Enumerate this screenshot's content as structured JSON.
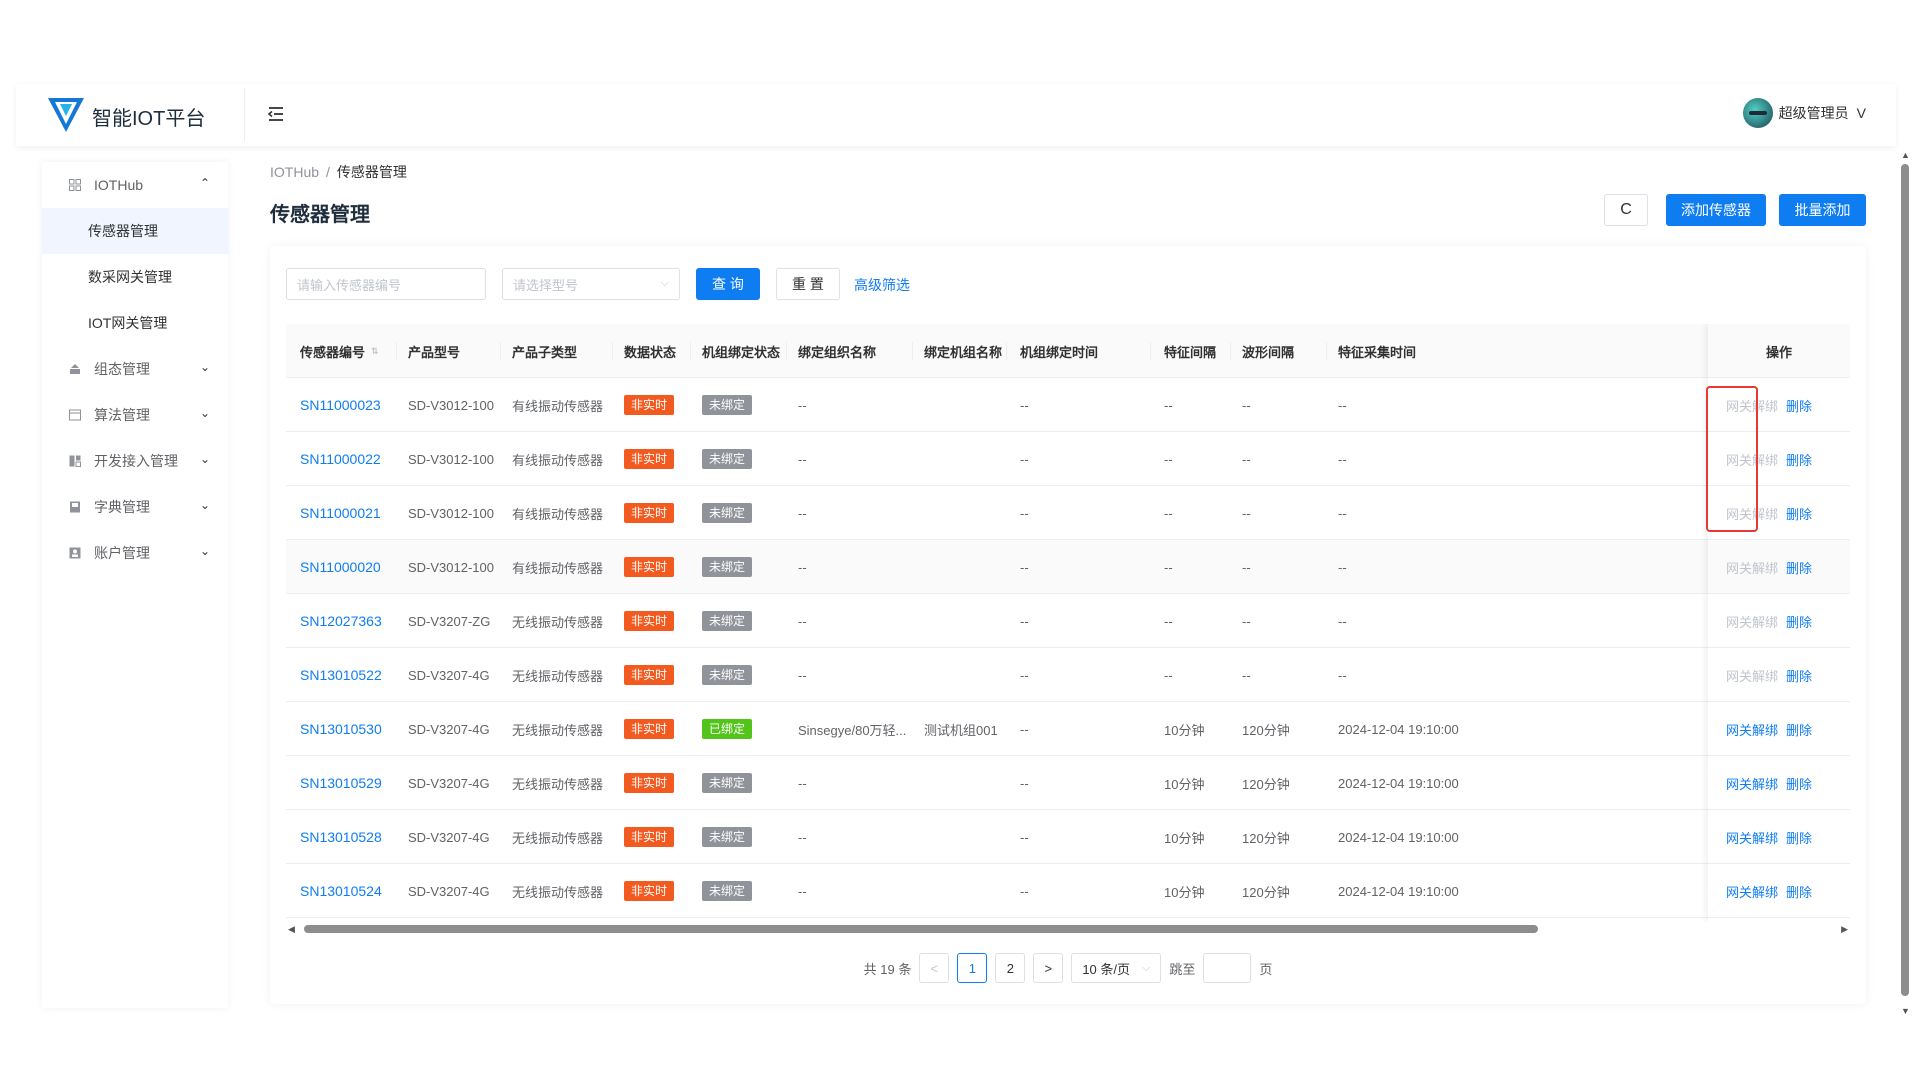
{
  "header": {
    "brand": "智能IOT平台",
    "user_name": "超级管理员",
    "user_chevron": "V"
  },
  "sidebar": {
    "groups": [
      {
        "label": "IOTHub",
        "icon": "grid-icon",
        "expanded": true,
        "items": [
          {
            "label": "传感器管理",
            "active": true
          },
          {
            "label": "数采网关管理",
            "active": false
          },
          {
            "label": "IOT网关管理",
            "active": false
          }
        ]
      },
      {
        "label": "组态管理",
        "icon": "layers-icon",
        "expanded": false,
        "items": []
      },
      {
        "label": "算法管理",
        "icon": "algorithm-icon",
        "expanded": false,
        "items": []
      },
      {
        "label": "开发接入管理",
        "icon": "dev-icon",
        "expanded": false,
        "items": []
      },
      {
        "label": "字典管理",
        "icon": "book-icon",
        "expanded": false,
        "items": []
      },
      {
        "label": "账户管理",
        "icon": "account-icon",
        "expanded": false,
        "items": []
      }
    ]
  },
  "breadcrumb": {
    "root": "IOTHub",
    "sep": "/",
    "current": "传感器管理"
  },
  "page_title": "传感器管理",
  "toolbar": {
    "refresh_icon": "C",
    "add_label": "添加传感器",
    "batch_label": "批量添加"
  },
  "filters": {
    "sn_placeholder": "请输入传感器编号",
    "model_placeholder": "请选择型号",
    "query_label": "查 询",
    "reset_label": "重 置",
    "advanced_label": "高级筛选"
  },
  "table": {
    "columns": [
      "传感器编号",
      "产品型号",
      "产品子类型",
      "数据状态",
      "机组绑定状态",
      "绑定组织名称",
      "绑定机组名称",
      "机组绑定时间",
      "特征间隔",
      "波形间隔",
      "特征采集时间",
      "操作"
    ],
    "rows": [
      {
        "sn": "SN11000023",
        "model": "SD-V3012-100",
        "subtype": "有线振动传感器",
        "data_status": "非实时",
        "bind_status": "未绑定",
        "bind_type": "grey",
        "org": "--",
        "unit": "",
        "bind_time": "--",
        "feat_int": "--",
        "wave_int": "--",
        "feat_time": "--",
        "op_unbind": "网关解绑",
        "op_unbind_enabled": false,
        "op_delete": "删除"
      },
      {
        "sn": "SN11000022",
        "model": "SD-V3012-100",
        "subtype": "有线振动传感器",
        "data_status": "非实时",
        "bind_status": "未绑定",
        "bind_type": "grey",
        "org": "--",
        "unit": "",
        "bind_time": "--",
        "feat_int": "--",
        "wave_int": "--",
        "feat_time": "--",
        "op_unbind": "网关解绑",
        "op_unbind_enabled": false,
        "op_delete": "删除"
      },
      {
        "sn": "SN11000021",
        "model": "SD-V3012-100",
        "subtype": "有线振动传感器",
        "data_status": "非实时",
        "bind_status": "未绑定",
        "bind_type": "grey",
        "org": "--",
        "unit": "",
        "bind_time": "--",
        "feat_int": "--",
        "wave_int": "--",
        "feat_time": "--",
        "op_unbind": "网关解绑",
        "op_unbind_enabled": false,
        "op_delete": "删除"
      },
      {
        "sn": "SN11000020",
        "model": "SD-V3012-100",
        "subtype": "有线振动传感器",
        "data_status": "非实时",
        "bind_status": "未绑定",
        "bind_type": "grey",
        "org": "--",
        "unit": "",
        "bind_time": "--",
        "feat_int": "--",
        "wave_int": "--",
        "feat_time": "--",
        "op_unbind": "网关解绑",
        "op_unbind_enabled": false,
        "op_delete": "删除"
      },
      {
        "sn": "SN12027363",
        "model": "SD-V3207-ZG",
        "subtype": "无线振动传感器",
        "data_status": "非实时",
        "bind_status": "未绑定",
        "bind_type": "grey",
        "org": "--",
        "unit": "",
        "bind_time": "--",
        "feat_int": "--",
        "wave_int": "--",
        "feat_time": "--",
        "op_unbind": "网关解绑",
        "op_unbind_enabled": false,
        "op_delete": "删除"
      },
      {
        "sn": "SN13010522",
        "model": "SD-V3207-4G",
        "subtype": "无线振动传感器",
        "data_status": "非实时",
        "bind_status": "未绑定",
        "bind_type": "grey",
        "org": "--",
        "unit": "",
        "bind_time": "--",
        "feat_int": "--",
        "wave_int": "--",
        "feat_time": "--",
        "op_unbind": "网关解绑",
        "op_unbind_enabled": false,
        "op_delete": "删除"
      },
      {
        "sn": "SN13010530",
        "model": "SD-V3207-4G",
        "subtype": "无线振动传感器",
        "data_status": "非实时",
        "bind_status": "已绑定",
        "bind_type": "green",
        "org": "Sinsegye/80万轻...",
        "unit": "测试机组001",
        "bind_time": "--",
        "feat_int": "10分钟",
        "wave_int": "120分钟",
        "feat_time": "2024-12-04 19:10:00",
        "op_unbind": "网关解绑",
        "op_unbind_enabled": true,
        "op_delete": "删除"
      },
      {
        "sn": "SN13010529",
        "model": "SD-V3207-4G",
        "subtype": "无线振动传感器",
        "data_status": "非实时",
        "bind_status": "未绑定",
        "bind_type": "grey",
        "org": "--",
        "unit": "",
        "bind_time": "--",
        "feat_int": "10分钟",
        "wave_int": "120分钟",
        "feat_time": "2024-12-04 19:10:00",
        "op_unbind": "网关解绑",
        "op_unbind_enabled": true,
        "op_delete": "删除"
      },
      {
        "sn": "SN13010528",
        "model": "SD-V3207-4G",
        "subtype": "无线振动传感器",
        "data_status": "非实时",
        "bind_status": "未绑定",
        "bind_type": "grey",
        "org": "--",
        "unit": "",
        "bind_time": "--",
        "feat_int": "10分钟",
        "wave_int": "120分钟",
        "feat_time": "2024-12-04 19:10:00",
        "op_unbind": "网关解绑",
        "op_unbind_enabled": true,
        "op_delete": "删除"
      },
      {
        "sn": "SN13010524",
        "model": "SD-V3207-4G",
        "subtype": "无线振动传感器",
        "data_status": "非实时",
        "bind_status": "未绑定",
        "bind_type": "grey",
        "org": "--",
        "unit": "",
        "bind_time": "--",
        "feat_int": "10分钟",
        "wave_int": "120分钟",
        "feat_time": "2024-12-04 19:10:00",
        "op_unbind": "网关解绑",
        "op_unbind_enabled": true,
        "op_delete": "删除"
      }
    ]
  },
  "pagination": {
    "total_label": "共 19 条",
    "prev": "<",
    "pages": [
      "1",
      "2"
    ],
    "current_page": "1",
    "next": ">",
    "page_size": "10 条/页",
    "jump_label": "跳至",
    "page_unit": "页"
  },
  "colors": {
    "primary": "#0f7df2",
    "tag_realtime_off": "#f25a1f",
    "tag_unbound": "#909399",
    "tag_bound": "#52c41a",
    "highlight": "#e53935"
  }
}
